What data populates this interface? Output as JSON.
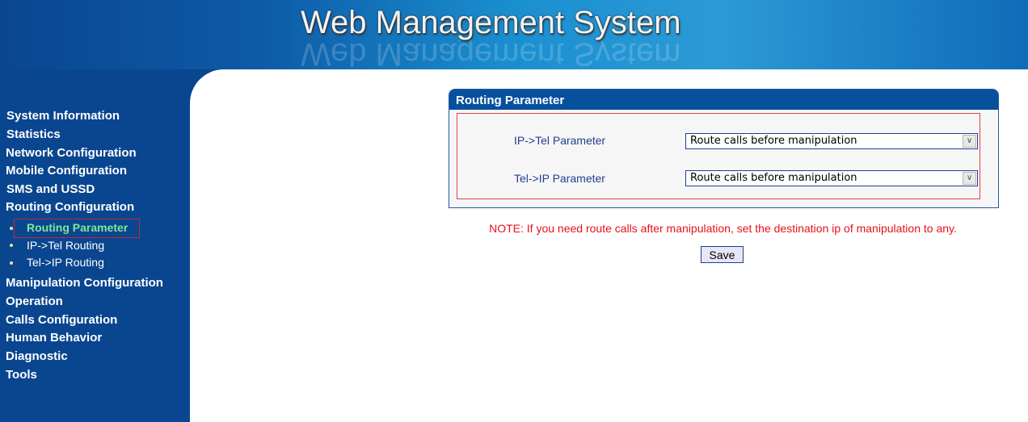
{
  "header": {
    "title": "Web Management System"
  },
  "sidebar": {
    "items": [
      "System Information",
      "Statistics",
      "Network Configuration",
      "Mobile Configuration",
      "SMS and USSD",
      "Routing Configuration"
    ],
    "sub_items": [
      "Routing Parameter",
      "IP->Tel Routing",
      "Tel->IP Routing"
    ],
    "items_after": [
      "Manipulation Configuration",
      "Operation",
      "Calls Configuration",
      "Human Behavior",
      "Diagnostic",
      "Tools"
    ],
    "selected": "Routing Parameter"
  },
  "panel": {
    "title": "Routing Parameter",
    "fields": [
      {
        "label": "IP->Tel Parameter",
        "value": "Route calls before manipulation"
      },
      {
        "label": "Tel->IP Parameter",
        "value": "Route calls before manipulation"
      }
    ]
  },
  "note": "NOTE: If you need route calls after manipulation, set the destination ip of manipulation to any.",
  "save_label": "Save",
  "colors": {
    "sidebar": "#0a4690",
    "active_link": "#7de89a",
    "note": "#e8101c"
  }
}
